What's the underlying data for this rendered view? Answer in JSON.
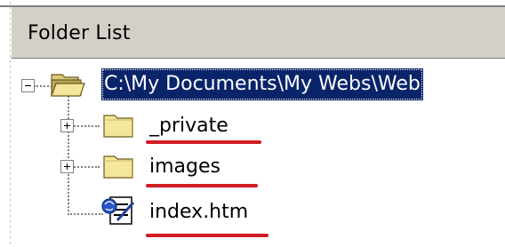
{
  "panel": {
    "title": "Folder List"
  },
  "tree": {
    "root": {
      "label": "C:\\My Documents\\My Webs\\Web",
      "expanded": true,
      "selected": true,
      "icon": "open-folder-icon"
    },
    "children": [
      {
        "label": "_private",
        "icon": "folder-icon",
        "expandable": true,
        "expanded": false
      },
      {
        "label": "images",
        "icon": "folder-icon",
        "expandable": true,
        "expanded": false
      },
      {
        "label": "index.htm",
        "icon": "html-page-icon",
        "expandable": false
      }
    ]
  },
  "colors": {
    "selection_bg": "#0a246a",
    "header_bg": "#d4d0c8",
    "annotation_underline": "#d01c24",
    "folder_yellow": "#f5e79a"
  }
}
